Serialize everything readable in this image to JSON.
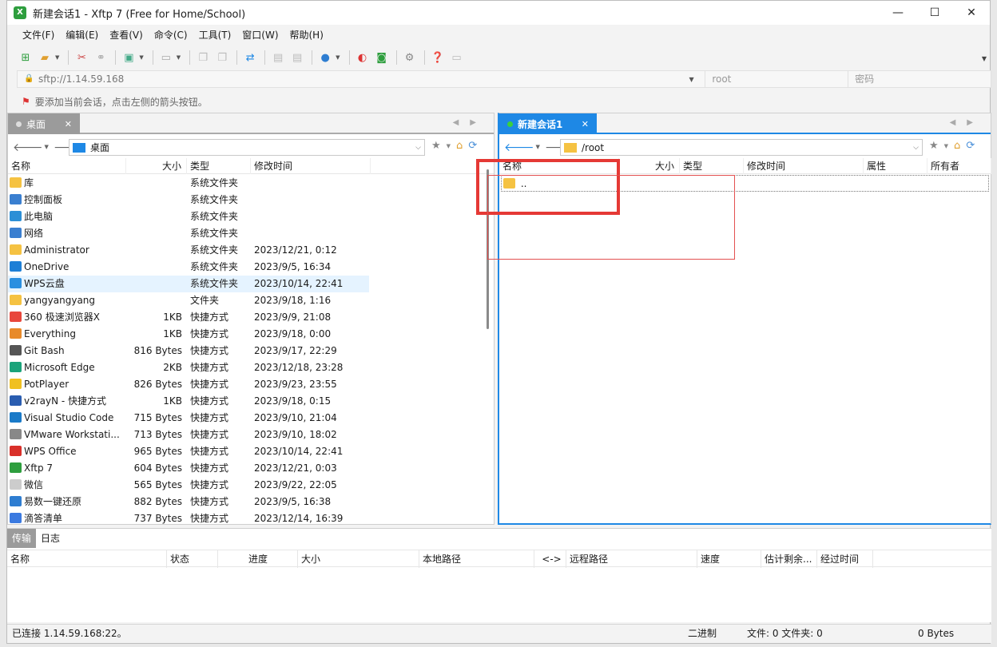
{
  "window": {
    "title": "新建会话1 - Xftp 7 (Free for Home/School)",
    "app_icon": "xftp-icon",
    "controls": [
      "minimize-icon",
      "maximize-icon",
      "close-icon"
    ]
  },
  "menu": [
    "文件(F)",
    "编辑(E)",
    "查看(V)",
    "命令(C)",
    "工具(T)",
    "窗口(W)",
    "帮助(H)"
  ],
  "address": {
    "url": "sftp://1.14.59.168",
    "user_placeholder": "root",
    "password_placeholder": "密码"
  },
  "hint": "要添加当前会话，点击左侧的箭头按钮。",
  "left_pane": {
    "tab_label": "桌面",
    "path": "桌面",
    "columns": [
      "名称",
      "大小",
      "类型",
      "修改时间"
    ],
    "rows": [
      {
        "name": "库",
        "size": "",
        "type": "系统文件夹",
        "modified": "",
        "icon": "library-folder-icon"
      },
      {
        "name": "控制面板",
        "size": "",
        "type": "系统文件夹",
        "modified": "",
        "icon": "control-panel-icon"
      },
      {
        "name": "此电脑",
        "size": "",
        "type": "系统文件夹",
        "modified": "",
        "icon": "computer-icon"
      },
      {
        "name": "网络",
        "size": "",
        "type": "系统文件夹",
        "modified": "",
        "icon": "network-icon"
      },
      {
        "name": "Administrator",
        "size": "",
        "type": "系统文件夹",
        "modified": "2023/12/21, 0:12",
        "icon": "user-folder-icon"
      },
      {
        "name": "OneDrive",
        "size": "",
        "type": "系统文件夹",
        "modified": "2023/9/5, 16:34",
        "icon": "onedrive-icon"
      },
      {
        "name": "WPS云盘",
        "size": "",
        "type": "系统文件夹",
        "modified": "2023/10/14, 22:41",
        "icon": "wps-cloud-icon"
      },
      {
        "name": "yangyangyang",
        "size": "",
        "type": "文件夹",
        "modified": "2023/9/18, 1:16",
        "icon": "folder-icon"
      },
      {
        "name": "360 极速浏览器X",
        "size": "1KB",
        "type": "快捷方式",
        "modified": "2023/9/9, 21:08",
        "icon": "360-browser-icon"
      },
      {
        "name": "Everything",
        "size": "1KB",
        "type": "快捷方式",
        "modified": "2023/9/18, 0:00",
        "icon": "everything-icon"
      },
      {
        "name": "Git Bash",
        "size": "816 Bytes",
        "type": "快捷方式",
        "modified": "2023/9/17, 22:29",
        "icon": "git-bash-icon"
      },
      {
        "name": "Microsoft Edge",
        "size": "2KB",
        "type": "快捷方式",
        "modified": "2023/12/18, 23:28",
        "icon": "edge-icon"
      },
      {
        "name": "PotPlayer",
        "size": "826 Bytes",
        "type": "快捷方式",
        "modified": "2023/9/23, 23:55",
        "icon": "potplayer-icon"
      },
      {
        "name": "v2rayN - 快捷方式",
        "size": "1KB",
        "type": "快捷方式",
        "modified": "2023/9/18, 0:15",
        "icon": "v2rayn-icon"
      },
      {
        "name": "Visual Studio Code",
        "size": "715 Bytes",
        "type": "快捷方式",
        "modified": "2023/9/10, 21:04",
        "icon": "vscode-icon"
      },
      {
        "name": "VMware Workstati...",
        "size": "713 Bytes",
        "type": "快捷方式",
        "modified": "2023/9/10, 18:02",
        "icon": "vmware-icon"
      },
      {
        "name": "WPS Office",
        "size": "965 Bytes",
        "type": "快捷方式",
        "modified": "2023/10/14, 22:41",
        "icon": "wps-office-icon"
      },
      {
        "name": "Xftp 7",
        "size": "604 Bytes",
        "type": "快捷方式",
        "modified": "2023/12/21, 0:03",
        "icon": "xftp-icon"
      },
      {
        "name": "微信",
        "size": "565 Bytes",
        "type": "快捷方式",
        "modified": "2023/9/22, 22:05",
        "icon": "wechat-icon"
      },
      {
        "name": "易数一键还原",
        "size": "882 Bytes",
        "type": "快捷方式",
        "modified": "2023/9/5, 16:38",
        "icon": "restore-icon"
      },
      {
        "name": "滴答清单",
        "size": "737 Bytes",
        "type": "快捷方式",
        "modified": "2023/12/14, 16:39",
        "icon": "ticktick-icon"
      }
    ]
  },
  "right_pane": {
    "tab_label": "新建会话1",
    "path": "/root",
    "columns": [
      "名称",
      "大小",
      "类型",
      "修改时间",
      "属性",
      "所有者"
    ],
    "rows": [
      {
        "name": "..",
        "icon": "folder-icon"
      }
    ]
  },
  "transfer": {
    "tabs": [
      "传输",
      "日志"
    ],
    "columns": [
      "名称",
      "状态",
      "进度",
      "大小",
      "本地路径",
      "<->",
      "远程路径",
      "速度",
      "估计剩余...",
      "经过时间"
    ]
  },
  "status": {
    "connection": "已连接 1.14.59.168:22。",
    "mode": "二进制",
    "files": "文件: 0  文件夹: 0",
    "bytes": "0 Bytes"
  },
  "colors": {
    "accent": "#1e88e5",
    "selection": "#e5f3ff",
    "annotation_red": "#e53935"
  }
}
